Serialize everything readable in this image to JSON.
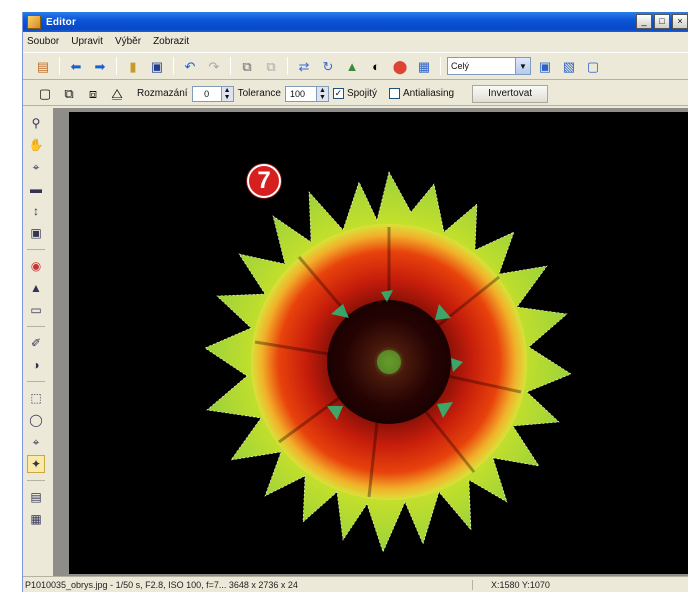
{
  "window": {
    "title": "Editor",
    "controls": {
      "minimize": "_",
      "maximize": "□",
      "close": "×"
    }
  },
  "menu": [
    "Soubor",
    "Upravit",
    "Výběr",
    "Zobrazit"
  ],
  "toolbar": {
    "icons": [
      "briefcase-icon",
      "arrow-left-icon",
      "arrow-right-icon",
      "open-folder-icon",
      "save-icon",
      "undo-icon",
      "redo-icon",
      "copy-icon",
      "paste-icon",
      "flip-icon",
      "rotate-icon",
      "image-adjust-icon",
      "contrast-icon",
      "color-balance-icon",
      "levels-icon"
    ],
    "zoom_value": "Celý",
    "view_buttons": [
      "fit-icon",
      "grid-icon",
      "fullscreen-icon"
    ]
  },
  "selection_toolbar": {
    "blur_label": "Rozmazání",
    "blur_value": "0",
    "tolerance_label": "Tolerance",
    "tolerance_value": "100",
    "contiguous_label": "Spojitý",
    "contiguous_checked": true,
    "antialias_label": "Antialiasing",
    "antialias_checked": false,
    "invert_label": "Invertovat"
  },
  "tools": [
    "zoom-icon",
    "hand-icon",
    "crop-icon",
    "straighten-icon",
    "resize-h-icon",
    "resize-icon",
    "redeye-icon",
    "clone-stamp-icon",
    "eraser-icon",
    "brush-icon",
    "fill-bucket-icon",
    "rect-select-icon",
    "lasso-icon",
    "magic-lasso-icon",
    "magic-wand-icon",
    "text-icon",
    "layers-icon"
  ],
  "annotation_badge": "7",
  "status": {
    "file_info": "P1010035_obrys.jpg - 1/50 s, F2.8, ISO 100, f=7...   3648 x 2736 x 24",
    "coords": "X:1580 Y:1070"
  },
  "colors": {
    "titlebar": "#0b56d8",
    "window_bg": "#ece9d8",
    "canvas_bg": "#000000",
    "badge": "#d62020"
  }
}
